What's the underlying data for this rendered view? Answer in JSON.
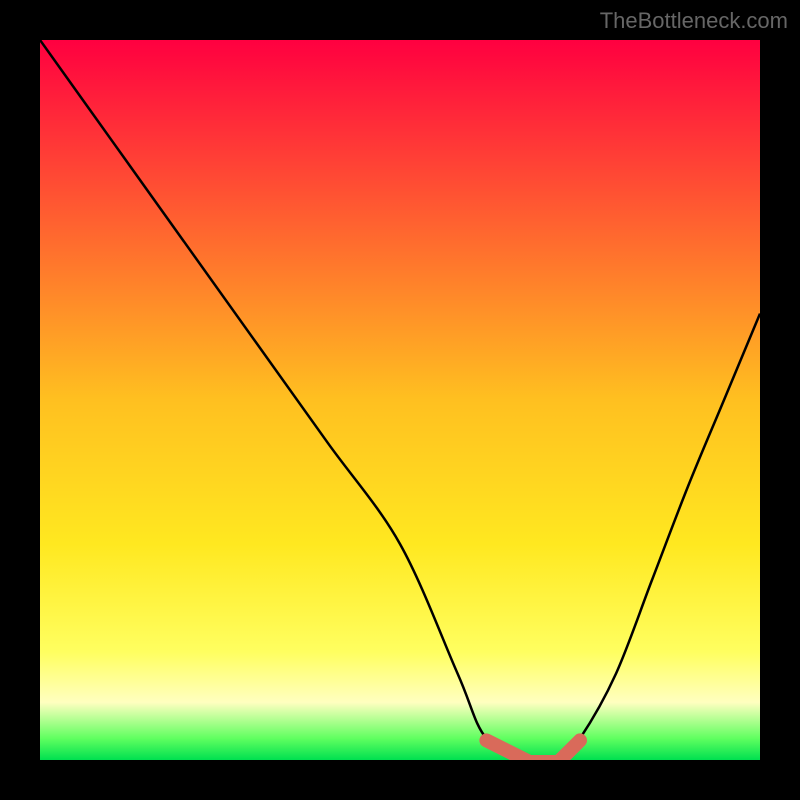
{
  "watermark": "TheBottleneck.com",
  "chart_data": {
    "type": "line",
    "title": "",
    "xlabel": "",
    "ylabel": "",
    "xlim": [
      0,
      100
    ],
    "ylim": [
      0,
      100
    ],
    "gradient_stops": [
      {
        "offset": 0,
        "color": "#ff0040"
      },
      {
        "offset": 25,
        "color": "#ff6030"
      },
      {
        "offset": 50,
        "color": "#ffc020"
      },
      {
        "offset": 70,
        "color": "#ffe820"
      },
      {
        "offset": 85,
        "color": "#ffff60"
      },
      {
        "offset": 92,
        "color": "#ffffc0"
      },
      {
        "offset": 97,
        "color": "#60ff60"
      },
      {
        "offset": 100,
        "color": "#00e050"
      }
    ],
    "series": [
      {
        "name": "bottleneck-curve",
        "x": [
          0,
          10,
          20,
          30,
          40,
          50,
          58,
          62,
          68,
          72,
          75,
          80,
          85,
          90,
          95,
          100
        ],
        "y": [
          100,
          86,
          72,
          58,
          44,
          30,
          12,
          3,
          0,
          0,
          3,
          12,
          25,
          38,
          50,
          62
        ]
      }
    ],
    "highlight": {
      "name": "optimal-zone",
      "x_start": 62,
      "x_end": 72,
      "color": "#d96a5a"
    }
  }
}
